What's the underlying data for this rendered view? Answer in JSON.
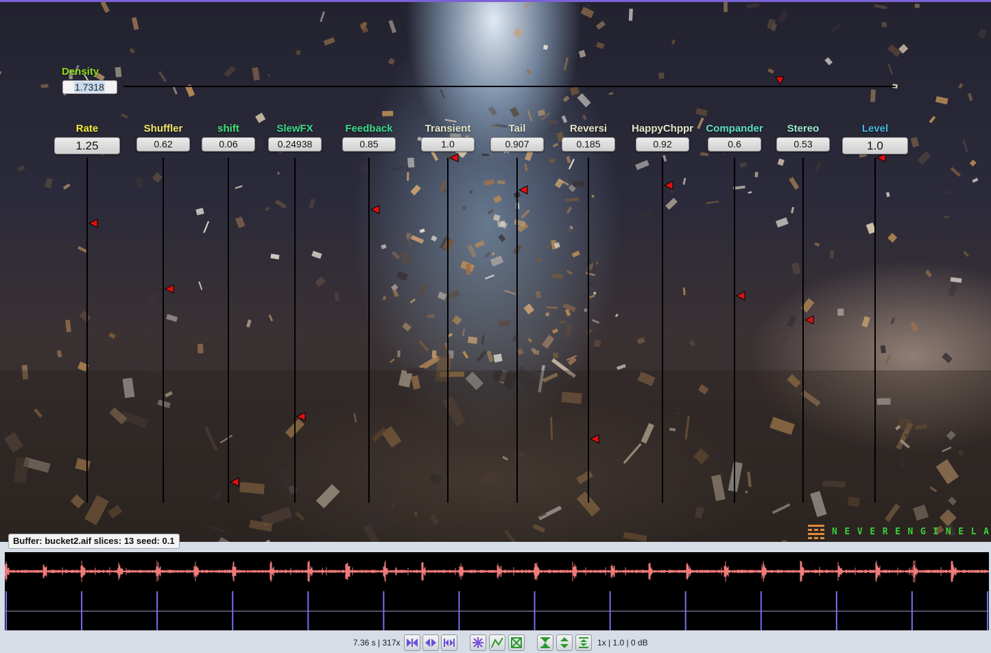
{
  "density": {
    "label": "Density",
    "value": "1.7318",
    "level": 0.85
  },
  "params": [
    {
      "id": "rate",
      "label": "Rate",
      "value": "1.25",
      "color": "#f2ea3a",
      "big": true,
      "level": 0.81
    },
    {
      "id": "shuffler",
      "label": "Shuffler",
      "value": "0.62",
      "color": "#f0e66a",
      "big": false,
      "level": 0.62
    },
    {
      "id": "shift",
      "label": "shift",
      "value": "0.06",
      "color": "#44e07a",
      "big": false,
      "level": 0.06
    },
    {
      "id": "slewfx",
      "label": "SlewFX",
      "value": "0.24938",
      "color": "#3ad98c",
      "big": false,
      "level": 0.25
    },
    {
      "id": "feedback",
      "label": "Feedback",
      "value": "0.85",
      "color": "#3ad98c",
      "big": false,
      "level": 0.85
    },
    {
      "id": "transient",
      "label": "Transient",
      "value": "1.0",
      "color": "#e6e6c8",
      "big": false,
      "level": 1.0
    },
    {
      "id": "tail",
      "label": "Tail",
      "value": "0.907",
      "color": "#e6e6c8",
      "big": false,
      "level": 0.907
    },
    {
      "id": "reversi",
      "label": "Reversi",
      "value": "0.185",
      "color": "#e6e6c8",
      "big": false,
      "level": 0.185
    },
    {
      "id": "happychppr",
      "label": "HappyChppr",
      "value": "0.92",
      "color": "#e6e6c8",
      "big": false,
      "level": 0.92
    },
    {
      "id": "compander",
      "label": "Compander",
      "value": "0.6",
      "color": "#5fe0c0",
      "big": false,
      "level": 0.6
    },
    {
      "id": "stereo",
      "label": "Stereo",
      "value": "0.53",
      "color": "#9fe8d0",
      "big": false,
      "level": 0.53
    },
    {
      "id": "level",
      "label": "Level",
      "value": "1.0",
      "color": "#44b8d8",
      "big": true,
      "level": 1.0
    }
  ],
  "logo": {
    "text": "NEVERENGINELABS",
    "color": "#3bd13b",
    "mark_color": "#e08a3a"
  },
  "buffer": {
    "label": "Buffer: bucket2.aif slices: 13 seed: 0.1",
    "slices": 13
  },
  "waveform": {
    "color": "#f07a7a",
    "slice_color": "#7b6cf0"
  },
  "toolbar": {
    "time_text": "7.36 s | 317x",
    "gain_text": "1x | 1.0 | 0 dB",
    "buttons": [
      {
        "id": "jump-start",
        "icon": "jump-start-icon"
      },
      {
        "id": "jump-both",
        "icon": "jump-both-icon"
      },
      {
        "id": "jump-end",
        "icon": "jump-end-icon"
      },
      {
        "id": "freeze",
        "icon": "snowflake-icon"
      },
      {
        "id": "envelope",
        "icon": "envelope-icon"
      },
      {
        "id": "random",
        "icon": "random-icon"
      },
      {
        "id": "zoom-in-vertical",
        "icon": "zoom-vertical-in-icon"
      },
      {
        "id": "zoom-out-vertical",
        "icon": "zoom-vertical-out-icon"
      },
      {
        "id": "zoom-fit-vertical",
        "icon": "zoom-vertical-fit-icon"
      }
    ]
  }
}
